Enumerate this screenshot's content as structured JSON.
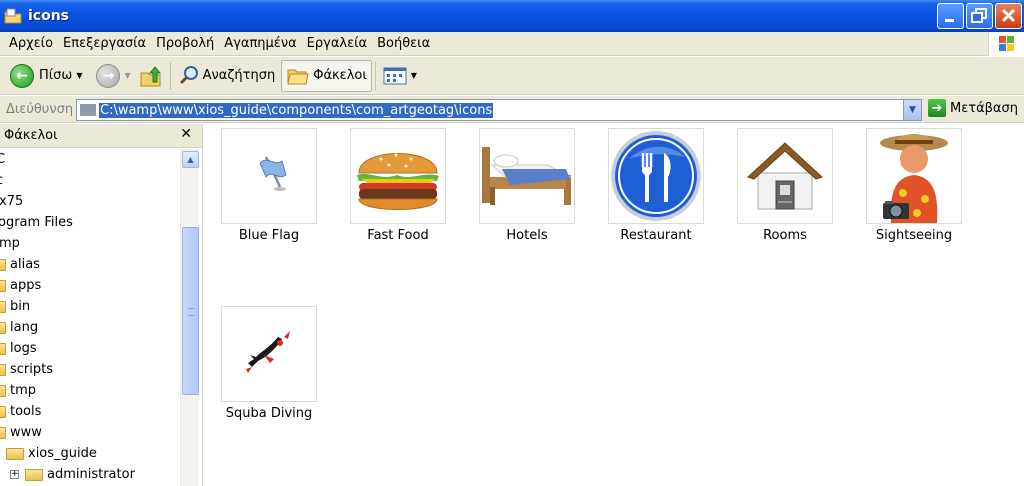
{
  "window": {
    "title": "icons"
  },
  "menu": [
    "Αρχείο",
    "Επεξεργασία",
    "Προβολή",
    "Αγαπημένα",
    "Εργαλεία",
    "Βοήθεια"
  ],
  "toolbar": {
    "back_label": "Πίσω",
    "search_label": "Αναζήτηση",
    "folders_label": "Φάκελοι"
  },
  "address": {
    "label": "Διεύθυνση",
    "path": "C:\\wamp\\www\\xios_guide\\components\\com_artgeotag\\icons",
    "go_label": "Μετάβαση"
  },
  "folder_pane": {
    "title": "Φάκελοι",
    "tree": [
      "C",
      "c",
      "x75",
      "ogram Files",
      "mp",
      "alias",
      "apps",
      "bin",
      "lang",
      "logs",
      "scripts",
      "tmp",
      "tools",
      "www",
      "xios_guide",
      "administrator"
    ]
  },
  "files": [
    {
      "name": "Blue Flag",
      "icon": "blue-flag-icon"
    },
    {
      "name": "Fast Food",
      "icon": "burger-icon"
    },
    {
      "name": "Hotels",
      "icon": "bed-icon"
    },
    {
      "name": "Restaurant",
      "icon": "fork-knife-icon"
    },
    {
      "name": "Rooms",
      "icon": "house-icon"
    },
    {
      "name": "Sightseeing",
      "icon": "tourist-icon"
    },
    {
      "name": "Squba Diving",
      "icon": "diver-icon"
    }
  ]
}
